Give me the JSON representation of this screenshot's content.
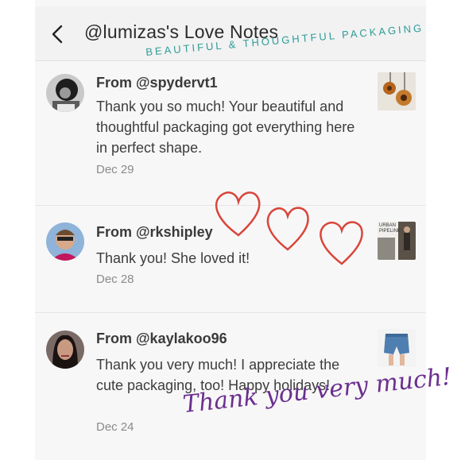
{
  "header": {
    "title": "@lumizas's Love Notes"
  },
  "overlay": {
    "banner": "BEAUTIFUL & THOUGHTFUL PACKAGING",
    "script": "Thank you very much!"
  },
  "notes": [
    {
      "from": "From @spydervt1",
      "message": "Thank you so much! Your beautiful and thoughtful packaging got everything here in perfect shape.",
      "date": "Dec 29"
    },
    {
      "from": "From @rkshipley",
      "message": "Thank you! She loved it!",
      "date": "Dec 28"
    },
    {
      "from": "From @kaylakoo96",
      "message": "Thank you very much! I appreciate the cute packaging, too! Happy holidays!",
      "date": "Dec 24"
    }
  ],
  "thumb_text": {
    "line1": "URBAN",
    "line2": "PIPELINE"
  },
  "colors": {
    "banner": "#2e9c98",
    "script": "#6b2f8f",
    "hearts": "#d9453b"
  }
}
